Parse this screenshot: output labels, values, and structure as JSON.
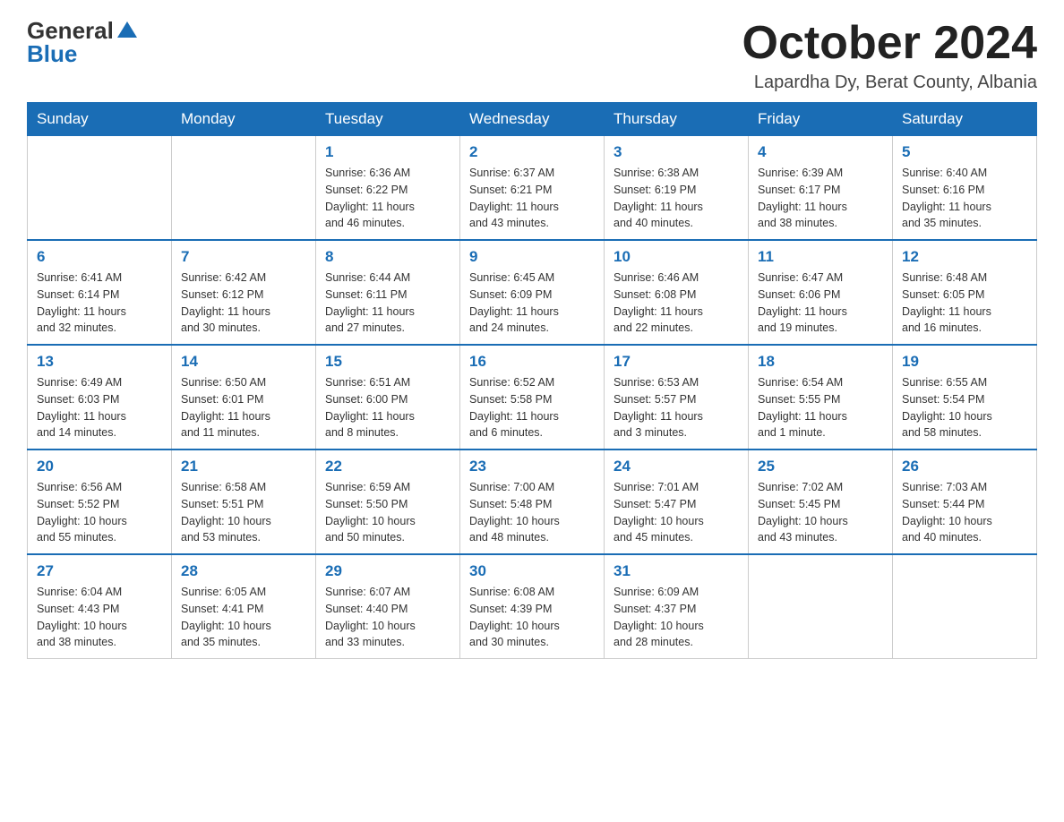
{
  "logo": {
    "general": "General",
    "blue": "Blue"
  },
  "title": "October 2024",
  "location": "Lapardha Dy, Berat County, Albania",
  "headers": [
    "Sunday",
    "Monday",
    "Tuesday",
    "Wednesday",
    "Thursday",
    "Friday",
    "Saturday"
  ],
  "weeks": [
    [
      {
        "day": "",
        "info": ""
      },
      {
        "day": "",
        "info": ""
      },
      {
        "day": "1",
        "info": "Sunrise: 6:36 AM\nSunset: 6:22 PM\nDaylight: 11 hours\nand 46 minutes."
      },
      {
        "day": "2",
        "info": "Sunrise: 6:37 AM\nSunset: 6:21 PM\nDaylight: 11 hours\nand 43 minutes."
      },
      {
        "day": "3",
        "info": "Sunrise: 6:38 AM\nSunset: 6:19 PM\nDaylight: 11 hours\nand 40 minutes."
      },
      {
        "day": "4",
        "info": "Sunrise: 6:39 AM\nSunset: 6:17 PM\nDaylight: 11 hours\nand 38 minutes."
      },
      {
        "day": "5",
        "info": "Sunrise: 6:40 AM\nSunset: 6:16 PM\nDaylight: 11 hours\nand 35 minutes."
      }
    ],
    [
      {
        "day": "6",
        "info": "Sunrise: 6:41 AM\nSunset: 6:14 PM\nDaylight: 11 hours\nand 32 minutes."
      },
      {
        "day": "7",
        "info": "Sunrise: 6:42 AM\nSunset: 6:12 PM\nDaylight: 11 hours\nand 30 minutes."
      },
      {
        "day": "8",
        "info": "Sunrise: 6:44 AM\nSunset: 6:11 PM\nDaylight: 11 hours\nand 27 minutes."
      },
      {
        "day": "9",
        "info": "Sunrise: 6:45 AM\nSunset: 6:09 PM\nDaylight: 11 hours\nand 24 minutes."
      },
      {
        "day": "10",
        "info": "Sunrise: 6:46 AM\nSunset: 6:08 PM\nDaylight: 11 hours\nand 22 minutes."
      },
      {
        "day": "11",
        "info": "Sunrise: 6:47 AM\nSunset: 6:06 PM\nDaylight: 11 hours\nand 19 minutes."
      },
      {
        "day": "12",
        "info": "Sunrise: 6:48 AM\nSunset: 6:05 PM\nDaylight: 11 hours\nand 16 minutes."
      }
    ],
    [
      {
        "day": "13",
        "info": "Sunrise: 6:49 AM\nSunset: 6:03 PM\nDaylight: 11 hours\nand 14 minutes."
      },
      {
        "day": "14",
        "info": "Sunrise: 6:50 AM\nSunset: 6:01 PM\nDaylight: 11 hours\nand 11 minutes."
      },
      {
        "day": "15",
        "info": "Sunrise: 6:51 AM\nSunset: 6:00 PM\nDaylight: 11 hours\nand 8 minutes."
      },
      {
        "day": "16",
        "info": "Sunrise: 6:52 AM\nSunset: 5:58 PM\nDaylight: 11 hours\nand 6 minutes."
      },
      {
        "day": "17",
        "info": "Sunrise: 6:53 AM\nSunset: 5:57 PM\nDaylight: 11 hours\nand 3 minutes."
      },
      {
        "day": "18",
        "info": "Sunrise: 6:54 AM\nSunset: 5:55 PM\nDaylight: 11 hours\nand 1 minute."
      },
      {
        "day": "19",
        "info": "Sunrise: 6:55 AM\nSunset: 5:54 PM\nDaylight: 10 hours\nand 58 minutes."
      }
    ],
    [
      {
        "day": "20",
        "info": "Sunrise: 6:56 AM\nSunset: 5:52 PM\nDaylight: 10 hours\nand 55 minutes."
      },
      {
        "day": "21",
        "info": "Sunrise: 6:58 AM\nSunset: 5:51 PM\nDaylight: 10 hours\nand 53 minutes."
      },
      {
        "day": "22",
        "info": "Sunrise: 6:59 AM\nSunset: 5:50 PM\nDaylight: 10 hours\nand 50 minutes."
      },
      {
        "day": "23",
        "info": "Sunrise: 7:00 AM\nSunset: 5:48 PM\nDaylight: 10 hours\nand 48 minutes."
      },
      {
        "day": "24",
        "info": "Sunrise: 7:01 AM\nSunset: 5:47 PM\nDaylight: 10 hours\nand 45 minutes."
      },
      {
        "day": "25",
        "info": "Sunrise: 7:02 AM\nSunset: 5:45 PM\nDaylight: 10 hours\nand 43 minutes."
      },
      {
        "day": "26",
        "info": "Sunrise: 7:03 AM\nSunset: 5:44 PM\nDaylight: 10 hours\nand 40 minutes."
      }
    ],
    [
      {
        "day": "27",
        "info": "Sunrise: 6:04 AM\nSunset: 4:43 PM\nDaylight: 10 hours\nand 38 minutes."
      },
      {
        "day": "28",
        "info": "Sunrise: 6:05 AM\nSunset: 4:41 PM\nDaylight: 10 hours\nand 35 minutes."
      },
      {
        "day": "29",
        "info": "Sunrise: 6:07 AM\nSunset: 4:40 PM\nDaylight: 10 hours\nand 33 minutes."
      },
      {
        "day": "30",
        "info": "Sunrise: 6:08 AM\nSunset: 4:39 PM\nDaylight: 10 hours\nand 30 minutes."
      },
      {
        "day": "31",
        "info": "Sunrise: 6:09 AM\nSunset: 4:37 PM\nDaylight: 10 hours\nand 28 minutes."
      },
      {
        "day": "",
        "info": ""
      },
      {
        "day": "",
        "info": ""
      }
    ]
  ]
}
